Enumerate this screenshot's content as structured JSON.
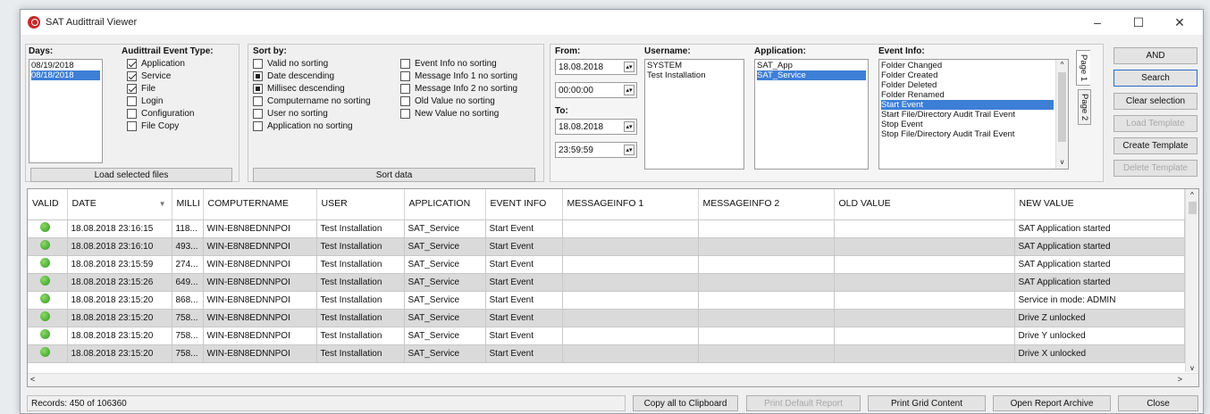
{
  "window": {
    "title": "SAT Audittrail Viewer",
    "minimize": "–",
    "maximize": "☐",
    "close": "✕"
  },
  "days": {
    "label": "Days:",
    "items": [
      "08/19/2018",
      "08/18/2018"
    ],
    "selected_index": 1,
    "load_button": "Load selected files"
  },
  "event_type": {
    "label": "Audittrail Event Type:",
    "items": [
      {
        "label": "Application",
        "checked": true
      },
      {
        "label": "Service",
        "checked": true
      },
      {
        "label": "File",
        "checked": true
      },
      {
        "label": "Login",
        "checked": false
      },
      {
        "label": "Configuration",
        "checked": false
      },
      {
        "label": "File Copy",
        "checked": false
      }
    ]
  },
  "sort": {
    "label": "Sort by:",
    "col1": [
      {
        "label": "Valid no sorting",
        "state": "empty"
      },
      {
        "label": "Date descending",
        "state": "filled"
      },
      {
        "label": "Millisec descending",
        "state": "filled"
      },
      {
        "label": "Computername no sorting",
        "state": "empty"
      },
      {
        "label": "User no sorting",
        "state": "empty"
      },
      {
        "label": "Application no sorting",
        "state": "empty"
      }
    ],
    "col2": [
      {
        "label": "Event Info no sorting",
        "state": "empty"
      },
      {
        "label": "Message Info 1 no sorting",
        "state": "empty"
      },
      {
        "label": "Message Info 2 no sorting",
        "state": "empty"
      },
      {
        "label": "Old Value no sorting",
        "state": "empty"
      },
      {
        "label": "New Value no sorting",
        "state": "empty"
      }
    ],
    "sort_button": "Sort data"
  },
  "filters": {
    "from_label": "From:",
    "from_date": "18.08.2018",
    "from_time": "00:00:00",
    "to_label": "To:",
    "to_date": "18.08.2018",
    "to_time": "23:59:59",
    "username_label": "Username:",
    "usernames": [
      "SYSTEM",
      "Test Installation"
    ],
    "application_label": "Application:",
    "applications": [
      "SAT_App",
      "SAT_Service"
    ],
    "application_selected": 1,
    "eventinfo_label": "Event Info:",
    "events": [
      "Folder Changed",
      "Folder Created",
      "Folder Deleted",
      "Folder Renamed",
      "Start Event",
      "Start File/Directory Audit Trail Event",
      "Stop Event",
      "Stop File/Directory Audit Trail Event"
    ],
    "event_selected": 4,
    "page1": "Page 1",
    "page2": "Page 2"
  },
  "right_buttons": {
    "and": "AND",
    "search": "Search",
    "clear": "Clear selection",
    "load_template": "Load Template",
    "create_template": "Create Template",
    "delete_template": "Delete Template"
  },
  "grid": {
    "columns": [
      "VALID",
      "DATE",
      "MILLI",
      "COMPUTERNAME",
      "USER",
      "APPLICATION",
      "EVENT INFO",
      "MESSAGEINFO 1",
      "MESSAGEINFO 2",
      "OLD VALUE",
      "NEW VALUE"
    ],
    "sort_indicator": "▼",
    "rows": [
      [
        "18.08.2018 23:16:15",
        "118...",
        "WIN-E8N8EDNNPOI",
        "Test Installation",
        "SAT_Service",
        "Start Event",
        "",
        "",
        "",
        "SAT Application started"
      ],
      [
        "18.08.2018 23:16:10",
        "493...",
        "WIN-E8N8EDNNPOI",
        "Test Installation",
        "SAT_Service",
        "Start Event",
        "",
        "",
        "",
        "SAT Application started"
      ],
      [
        "18.08.2018 23:15:59",
        "274...",
        "WIN-E8N8EDNNPOI",
        "Test Installation",
        "SAT_Service",
        "Start Event",
        "",
        "",
        "",
        "SAT Application started"
      ],
      [
        "18.08.2018 23:15:26",
        "649...",
        "WIN-E8N8EDNNPOI",
        "Test Installation",
        "SAT_Service",
        "Start Event",
        "",
        "",
        "",
        "SAT Application started"
      ],
      [
        "18.08.2018 23:15:20",
        "868...",
        "WIN-E8N8EDNNPOI",
        "Test Installation",
        "SAT_Service",
        "Start Event",
        "",
        "",
        "",
        "Service in mode: ADMIN"
      ],
      [
        "18.08.2018 23:15:20",
        "758...",
        "WIN-E8N8EDNNPOI",
        "Test Installation",
        "SAT_Service",
        "Start Event",
        "",
        "",
        "",
        "Drive Z unlocked"
      ],
      [
        "18.08.2018 23:15:20",
        "758...",
        "WIN-E8N8EDNNPOI",
        "Test Installation",
        "SAT_Service",
        "Start Event",
        "",
        "",
        "",
        "Drive Y unlocked"
      ],
      [
        "18.08.2018 23:15:20",
        "758...",
        "WIN-E8N8EDNNPOI",
        "Test Installation",
        "SAT_Service",
        "Start Event",
        "",
        "",
        "",
        "Drive X unlocked"
      ]
    ]
  },
  "status": {
    "records": "Records: 450 of 106360"
  },
  "bottom_buttons": {
    "copy": "Copy all to Clipboard",
    "print_default": "Print Default Report",
    "print_grid": "Print Grid Content",
    "open_archive": "Open Report Archive",
    "close": "Close"
  }
}
